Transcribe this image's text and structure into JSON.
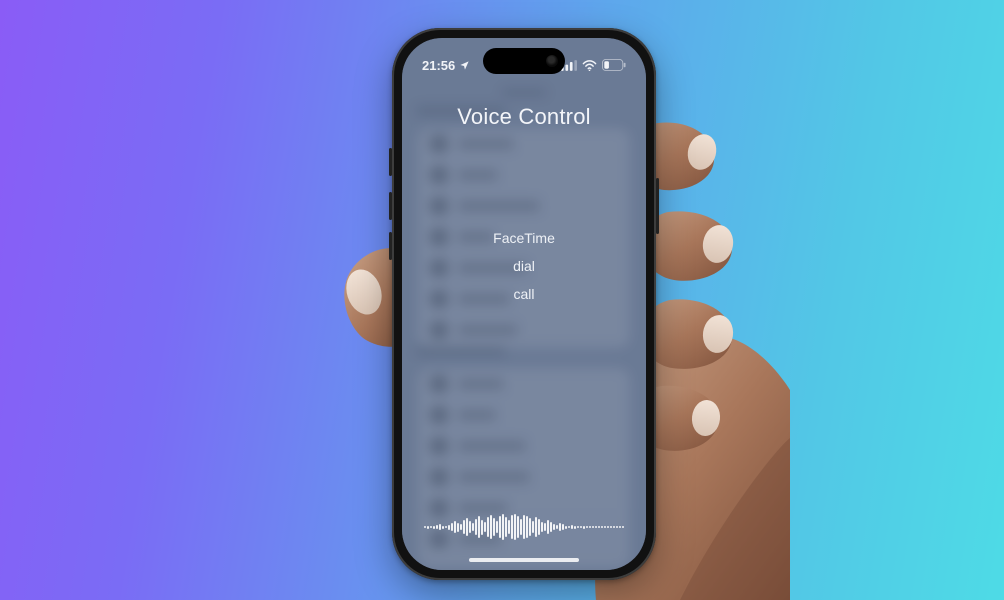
{
  "status": {
    "time": "21:56",
    "location_icon": "location-arrow",
    "signal_icon": "cellular-bars",
    "wifi_icon": "wifi",
    "battery_icon": "battery-low"
  },
  "voice_control": {
    "title": "Voice Control",
    "hints": [
      "FaceTime",
      "dial",
      "call"
    ]
  },
  "waveform": {
    "bars": [
      2,
      3,
      2,
      3,
      4,
      6,
      3,
      2,
      5,
      8,
      12,
      9,
      6,
      14,
      18,
      12,
      8,
      16,
      22,
      15,
      10,
      20,
      24,
      18,
      12,
      22,
      26,
      20,
      14,
      24,
      26,
      22,
      16,
      24,
      22,
      18,
      12,
      20,
      16,
      10,
      8,
      14,
      10,
      6,
      4,
      8,
      6,
      3,
      2,
      4,
      3,
      2,
      2,
      3,
      2,
      2,
      2,
      2,
      2,
      2,
      2,
      2,
      2,
      2,
      2,
      2,
      2
    ]
  },
  "colors": {
    "gradient_left": "#8a5cf6",
    "gradient_right": "#4edbe6",
    "overlay_tint": "#6d7e99"
  }
}
